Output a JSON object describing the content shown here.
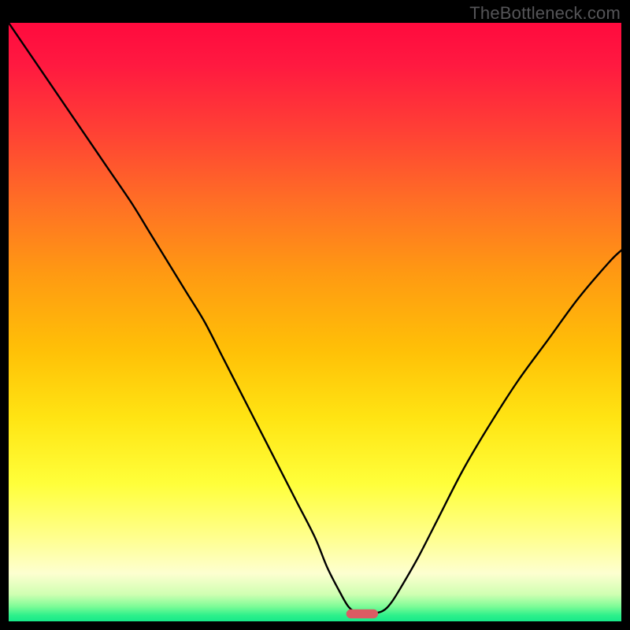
{
  "watermark": "TheBottleneck.com",
  "chart_data": {
    "type": "line",
    "title": "",
    "xlabel": "",
    "ylabel": "",
    "xlim": [
      0,
      100
    ],
    "ylim": [
      0,
      100
    ],
    "gradient_stops": [
      {
        "pos": 0.0,
        "color": "#ff0a3e"
      },
      {
        "pos": 0.07,
        "color": "#ff1940"
      },
      {
        "pos": 0.18,
        "color": "#ff4035"
      },
      {
        "pos": 0.3,
        "color": "#ff6f25"
      },
      {
        "pos": 0.42,
        "color": "#ff9a12"
      },
      {
        "pos": 0.55,
        "color": "#ffc107"
      },
      {
        "pos": 0.66,
        "color": "#ffe413"
      },
      {
        "pos": 0.77,
        "color": "#ffff3a"
      },
      {
        "pos": 0.86,
        "color": "#ffff8e"
      },
      {
        "pos": 0.92,
        "color": "#fdffd0"
      },
      {
        "pos": 0.955,
        "color": "#d0ffb2"
      },
      {
        "pos": 0.975,
        "color": "#7efc97"
      },
      {
        "pos": 0.99,
        "color": "#2df08b"
      },
      {
        "pos": 1.0,
        "color": "#18e989"
      }
    ],
    "curve": {
      "x": [
        0,
        4,
        8,
        12,
        16,
        20,
        23,
        26,
        29,
        32,
        35,
        38,
        41,
        44,
        47,
        50,
        52,
        54,
        55.5,
        57,
        59,
        61,
        62.5,
        64.5,
        67,
        70,
        74,
        78,
        83,
        88,
        93,
        98,
        100
      ],
      "y": [
        100,
        94,
        88,
        82,
        76,
        70,
        65,
        60,
        55,
        50,
        44,
        38,
        32,
        26,
        20,
        14,
        9,
        5,
        2.4,
        1.4,
        1.3,
        1.7,
        3.2,
        6.5,
        11,
        17,
        25,
        32,
        40,
        47,
        54,
        60,
        62
      ]
    },
    "marker": {
      "x_center": 57.7,
      "y_center": 1.25,
      "rx": 2.6,
      "ry": 0.75,
      "color": "#db5b63"
    },
    "grid": false
  }
}
